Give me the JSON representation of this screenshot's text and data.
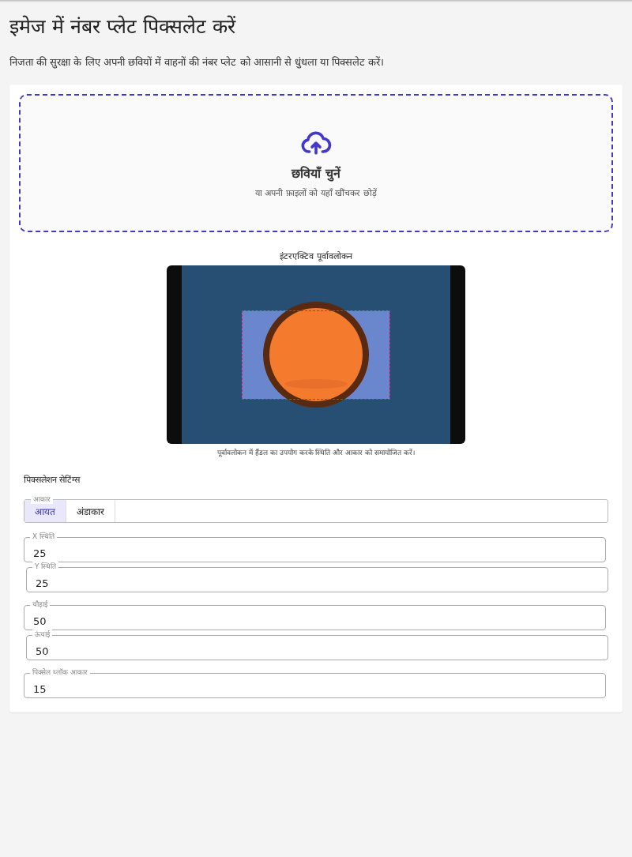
{
  "title": "इमेज में नंबर प्लेट पिक्सलेट करें",
  "subtitle": "निजता की सुरक्षा के लिए अपनी छवियों में वाहनों की नंबर प्लेट को आसानी से धुंधला या पिक्सलेट करें।",
  "upload": {
    "title": "छवियाँ चुनें",
    "hint": "या अपनी फ़ाइलों को यहाँ खींचकर छोड़ें"
  },
  "preview": {
    "title": "इंटरएक्टिव पूर्वावलोकन",
    "caption": "पूर्वावलोकन में हैंडल का उपयोग करके स्थिति और आकार को समायोजित करें।"
  },
  "settings": {
    "title": "पिक्सलेशन सेटिंग्स",
    "shape": {
      "label": "आकार",
      "options": [
        {
          "label": "आयत",
          "selected": true
        },
        {
          "label": "अंडाकार",
          "selected": false
        }
      ]
    },
    "fields": [
      {
        "label": "X स्थिति",
        "value": "25"
      },
      {
        "label": "Y स्थिति",
        "value": "25"
      },
      {
        "label": "चौड़ाई",
        "value": "50"
      },
      {
        "label": "ऊंचाई",
        "value": "50"
      },
      {
        "label": "पिक्सेल ब्लॉक आकार",
        "value": "15"
      }
    ]
  }
}
